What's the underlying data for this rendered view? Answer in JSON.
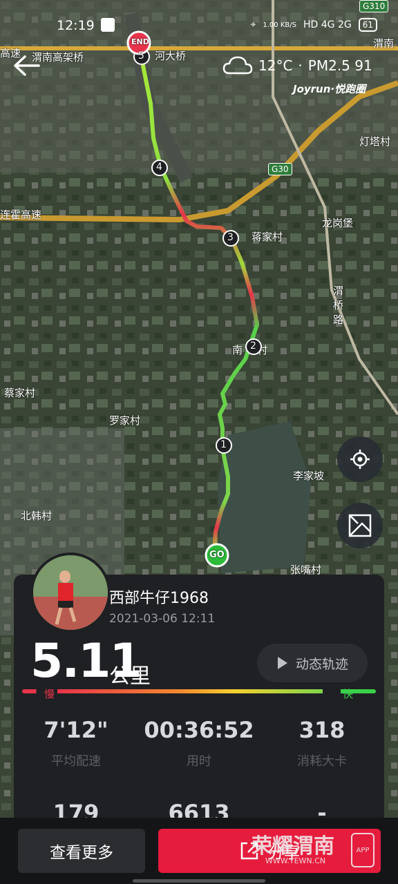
{
  "status_bar": {
    "time": "12:19",
    "speed": "1.00 KB/S",
    "network": "HD 4G 2G",
    "battery": "61"
  },
  "header": {
    "temperature": "12°C",
    "air_quality": "PM2.5 91",
    "brand": "Joyrun·悦跑圈"
  },
  "map": {
    "labels": [
      "渭南高架桥",
      "河大桥",
      "灯塔村",
      "蒋家村",
      "龙岗堡",
      "渭桥路",
      "南",
      "村",
      "蔡家村",
      "罗家村",
      "李家坡",
      "北韩村",
      "张嘴村",
      "连霍高速",
      "高速",
      "渭南"
    ],
    "shields": [
      "G30",
      "G310"
    ],
    "markers": {
      "start": "GO",
      "end": "END",
      "km": [
        "1",
        "2",
        "3",
        "4",
        "5"
      ]
    }
  },
  "profile": {
    "name": "西部牛仔1968",
    "datetime": "2021-03-06 12:11"
  },
  "run": {
    "distance": "5.11",
    "unit": "公里",
    "replay_label": "动态轨迹",
    "slow_label": "慢",
    "fast_label": "快"
  },
  "stats": [
    {
      "value": "7'12\"",
      "label": "平均配速"
    },
    {
      "value": "00:36:52",
      "label": "用时"
    },
    {
      "value": "318",
      "label": "消耗大卡"
    },
    {
      "value": "179",
      "label": ""
    },
    {
      "value": "6613",
      "label": ""
    },
    {
      "value": "-",
      "label": ""
    }
  ],
  "actions": {
    "more": "查看更多",
    "share": "分享"
  },
  "watermark": {
    "text": "荣耀渭南",
    "url": "WWW.YEWN.CN",
    "app": "APP"
  }
}
